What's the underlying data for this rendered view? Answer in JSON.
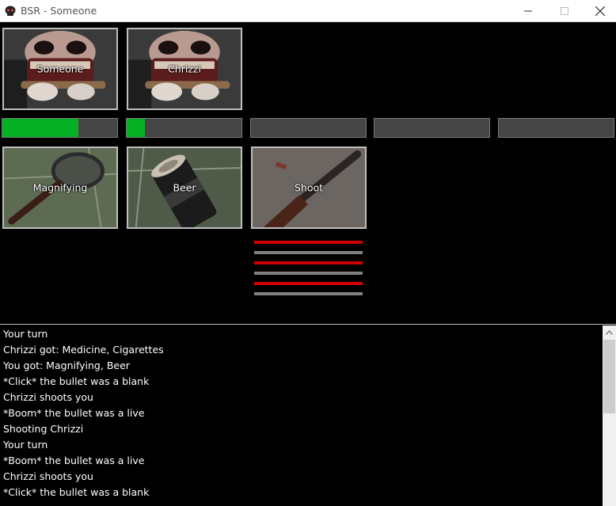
{
  "window": {
    "title": "BSR - Someone"
  },
  "players": [
    {
      "name": "Someone",
      "health_fraction": 0.66
    },
    {
      "name": "Chrizzi",
      "health_fraction": 0.16
    }
  ],
  "empty_health_bars": 3,
  "items": [
    {
      "label": "Magnifying",
      "icon": "magnifying-glass-icon"
    },
    {
      "label": "Beer",
      "icon": "beer-can-icon"
    },
    {
      "label": "Shoot",
      "icon": "shotgun-icon"
    }
  ],
  "shells": [
    "live",
    "blank",
    "live",
    "blank",
    "live",
    "blank"
  ],
  "colors": {
    "health": "#06b025",
    "live_shell": "#d10000",
    "blank_shell": "#808080"
  },
  "log": [
    "Your turn",
    "Chrizzi got: Medicine, Cigarettes",
    "You got: Magnifying, Beer",
    "*Click* the bullet was a blank",
    "Chrizzi shoots you",
    "*Boom* the bullet was a live",
    "Shooting Chrizzi",
    "Your turn",
    "*Boom* the bullet was a live",
    "Chrizzi shoots you",
    "*Click* the bullet was a blank"
  ]
}
